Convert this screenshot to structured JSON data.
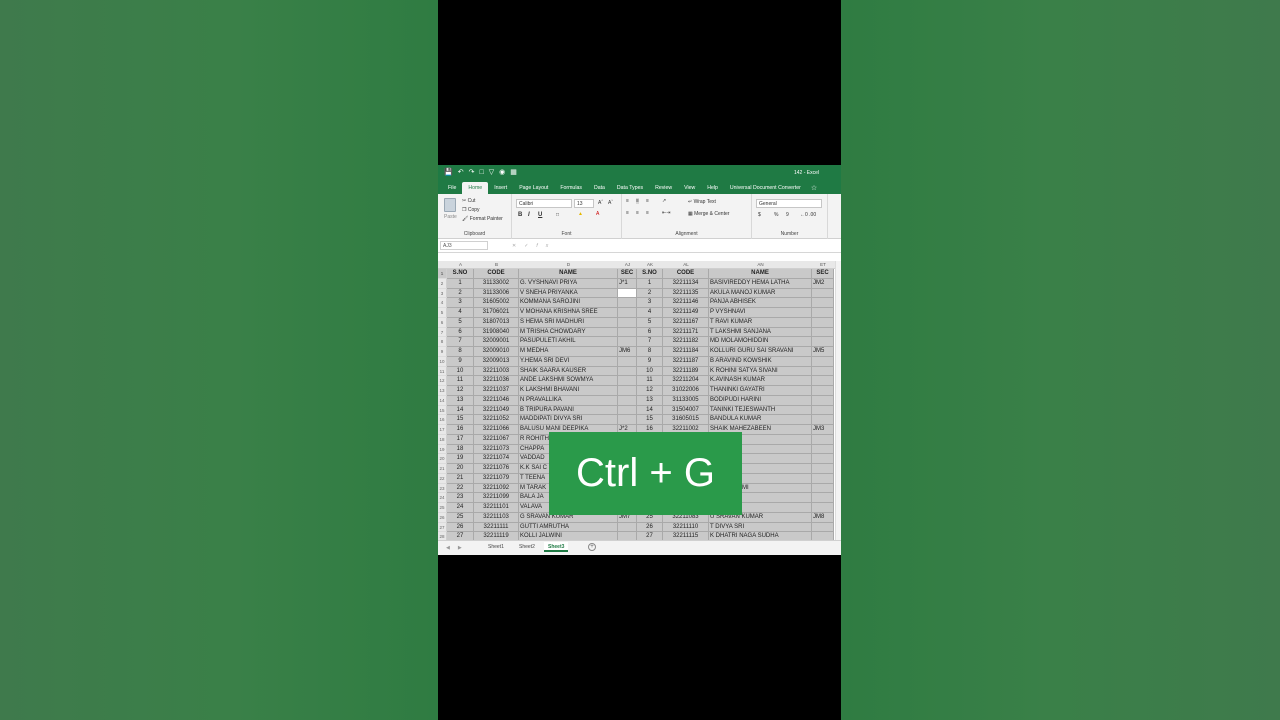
{
  "window": {
    "title": "142 - Excel"
  },
  "ribbon_tabs": [
    "File",
    "Home",
    "Insert",
    "Page Layout",
    "Formulas",
    "Data",
    "Data Types",
    "Review",
    "View",
    "Help",
    "Universal Document Converter"
  ],
  "active_tab": "Home",
  "clipboard": {
    "paste": "Paste",
    "cut": "Cut",
    "copy": "Copy",
    "format_painter": "Format Painter",
    "label": "Clipboard"
  },
  "font": {
    "name": "Calibri",
    "size": "13",
    "label": "Font",
    "bold": "B",
    "italic": "I",
    "underline": "U"
  },
  "alignment": {
    "wrap": "Wrap Text",
    "merge": "Merge & Center",
    "label": "Alignment"
  },
  "number": {
    "format": "General",
    "currency": "$",
    "percent": "%",
    "comma": "9",
    "label": "Number"
  },
  "name_box": "AJ3",
  "columns": [
    "A",
    "B",
    "D",
    "AJ",
    "AK",
    "AL",
    "AN",
    "ET"
  ],
  "headers": [
    "S.NO",
    "CODE",
    "NAME",
    "SEC",
    "S.NO",
    "CODE",
    "NAME",
    "SEC"
  ],
  "rows": [
    [
      "1",
      "31133002",
      "G. VYSHNAVI PRIYA",
      "J*1",
      "1",
      "32211134",
      "BASIVIREDDY HEMA LATHA",
      "JM2"
    ],
    [
      "2",
      "31133006",
      "V SNEHA PRIYANKA",
      "",
      "2",
      "32211135",
      "AKULA MANOJ KUMAR",
      ""
    ],
    [
      "3",
      "31605002",
      "KOMMANA SAROJINI",
      "",
      "3",
      "32211146",
      "PANJA ABHISEK",
      ""
    ],
    [
      "4",
      "31706021",
      "V MOHANA KRISHNA SREE",
      "",
      "4",
      "32211149",
      "P VYSHNAVI",
      ""
    ],
    [
      "5",
      "31807013",
      "S HEMA SRI MADHURI",
      "",
      "5",
      "32211167",
      "T RAVI KUMAR",
      ""
    ],
    [
      "6",
      "31908040",
      "M TRISHA CHOWDARY",
      "",
      "6",
      "32211171",
      "T LAKSHMI SANJANA",
      ""
    ],
    [
      "7",
      "32009001",
      "PASUPULETI AKHIL",
      "",
      "7",
      "32211182",
      "MD MOLAMOHIDDIN",
      ""
    ],
    [
      "8",
      "32009010",
      "M MEDHA",
      "JM6",
      "8",
      "32211184",
      "KOLLURI GURU SAI SRAVANI",
      "JM5"
    ],
    [
      "9",
      "32009013",
      "Y.HEMA SRI DEVI",
      "",
      "9",
      "32211187",
      "B ARAVIND KOWSHIK",
      ""
    ],
    [
      "10",
      "32211003",
      "SHAIK SAARA KAUSER",
      "",
      "10",
      "32211189",
      "K ROHINI SATYA SIVANI",
      ""
    ],
    [
      "11",
      "32211036",
      "ANDE LAKSHMI SOWMYA",
      "",
      "11",
      "32211204",
      "K.AVINASH KUMAR",
      ""
    ],
    [
      "12",
      "32211037",
      "K LAKSHMI BHAVANI",
      "",
      "12",
      "31022006",
      "THANINKI GAYATRI",
      ""
    ],
    [
      "13",
      "32211046",
      "N PRAVALLIKA",
      "",
      "13",
      "31133005",
      "BODIPUDI HARINI",
      ""
    ],
    [
      "14",
      "32211049",
      "B TRIPURA PAVANI",
      "",
      "14",
      "31504007",
      "TANINKI TEJESWANTH",
      ""
    ],
    [
      "15",
      "32211052",
      "MADDIPATI DIVYA SRI",
      "",
      "15",
      "31605015",
      "BANDULA KUMAR",
      ""
    ],
    [
      "16",
      "32211066",
      "BALUSU MANI DEEPIKA",
      "J*2",
      "16",
      "32211002",
      "SHAIK MAHEZABEEN",
      "JM3"
    ],
    [
      "17",
      "32211067",
      "R ROHITH",
      "",
      "17",
      "",
      "A MEHER",
      ""
    ],
    [
      "18",
      "32211073",
      "CHAPPA",
      "",
      "18",
      "",
      "AMITHA",
      ""
    ],
    [
      "19",
      "32211074",
      "VADDAD",
      "",
      "19",
      "",
      "ANK",
      ""
    ],
    [
      "20",
      "32211076",
      "K.K SAI C",
      "",
      "20",
      "",
      "IUN",
      ""
    ],
    [
      "21",
      "32211079",
      "T TEENA",
      "",
      "21",
      "",
      "KHIL",
      ""
    ],
    [
      "22",
      "32211092",
      "M TARAK",
      "",
      "22",
      "",
      "AHALAKSHMI",
      ""
    ],
    [
      "23",
      "32211099",
      "BALA JA",
      "",
      "23",
      "",
      "AMRUTHA",
      ""
    ],
    [
      "24",
      "32211101",
      "VALAVA",
      "",
      "24",
      "",
      "A ASHOK",
      ""
    ],
    [
      "25",
      "32211103",
      "G SRAVAN KUMAR",
      "JM7",
      "25",
      "32211083",
      "U SRAVAN KUMAR",
      "JM8"
    ],
    [
      "26",
      "32211111",
      "GUTTI AMRUTHA",
      "",
      "26",
      "32211110",
      "T DIVYA SRI",
      ""
    ],
    [
      "27",
      "32211119",
      "KOLLI JALWINI",
      "",
      "27",
      "32211115",
      "K DHATRI NAGA SUDHA",
      ""
    ]
  ],
  "sheets": [
    "Sheet1",
    "Sheet2",
    "Sheet3"
  ],
  "active_sheet": "Sheet3",
  "overlay_text": "Ctrl + G"
}
